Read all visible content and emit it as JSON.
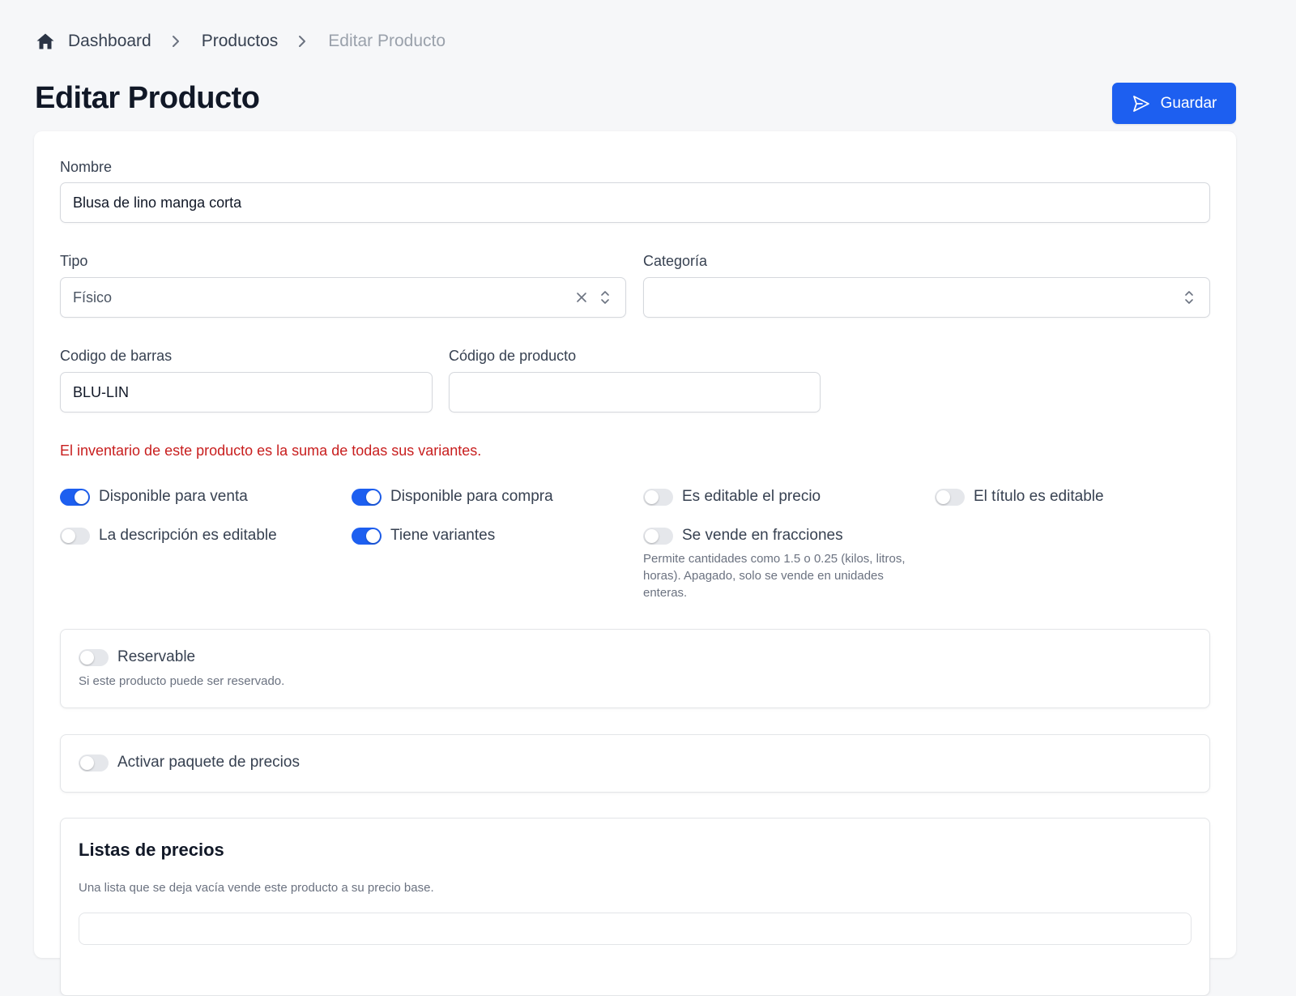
{
  "breadcrumb": {
    "home_icon": "home-icon",
    "items": [
      "Dashboard",
      "Productos",
      "Editar Producto"
    ]
  },
  "page": {
    "title": "Editar Producto",
    "save_label": "Guardar",
    "save_icon": "send-icon"
  },
  "form": {
    "nombre": {
      "label": "Nombre",
      "value": "Blusa de lino manga corta"
    },
    "tipo": {
      "label": "Tipo",
      "value": "Físico"
    },
    "categoria": {
      "label": "Categoría",
      "value": ""
    },
    "codigo_barras": {
      "label": "Codigo de barras",
      "value": "BLU-LIN"
    },
    "codigo_producto": {
      "label": "Código de producto",
      "value": ""
    },
    "inventory_warning": "El inventario de este producto es la suma de todas sus variantes.",
    "toggles": [
      {
        "label": "Disponible para venta",
        "on": true
      },
      {
        "label": "Disponible para compra",
        "on": true
      },
      {
        "label": "Es editable el precio",
        "on": false
      },
      {
        "label": "El título es editable",
        "on": false
      },
      {
        "label": "La descripción es editable",
        "on": false
      },
      {
        "label": "Tiene variantes",
        "on": true
      },
      {
        "label": "Se vende en fracciones",
        "on": false
      }
    ],
    "fractions_help": "Permite cantidades como 1.5 o 0.25 (kilos, litros, horas). Apagado, solo se vende en unidades enteras.",
    "reservable": {
      "label": "Reservable",
      "help": "Si este producto puede ser reservado.",
      "on": false
    },
    "price_package": {
      "label": "Activar paquete de precios",
      "on": false
    },
    "price_lists": {
      "title": "Listas de precios",
      "help": "Una lista que se deja vacía vende este producto a su precio base."
    }
  },
  "colors": {
    "accent": "#1d5ff0",
    "warning": "#c81e1e",
    "toggle_off": "#e5e7eb"
  }
}
